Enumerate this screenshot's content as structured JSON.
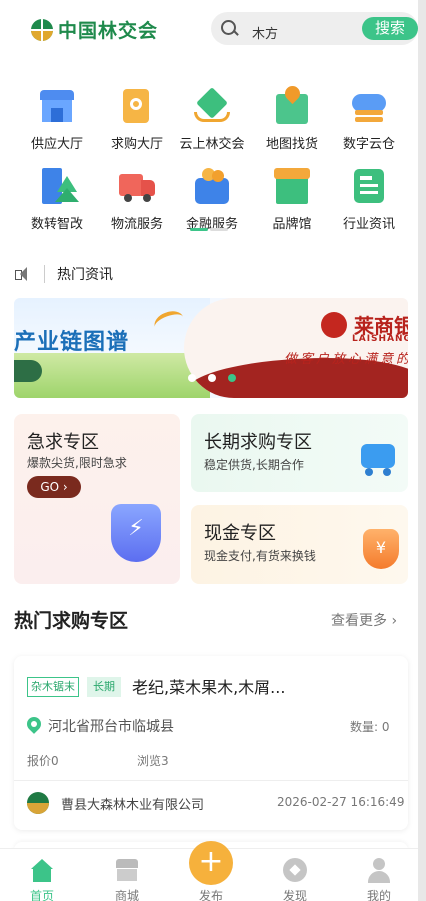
{
  "header": {
    "logo_text": "中国林交会",
    "search_value": "木方",
    "search_button": "搜索"
  },
  "grid": [
    {
      "label": "供应大厅",
      "icon": "warehouse-icon"
    },
    {
      "label": "求购大厅",
      "icon": "purchase-search-icon"
    },
    {
      "label": "云上林交会",
      "icon": "cloud-fair-cube-icon"
    },
    {
      "label": "地图找货",
      "icon": "map-pin-icon"
    },
    {
      "label": "数字云仓",
      "icon": "cloud-storage-icon"
    },
    {
      "label": "数转智改",
      "icon": "digital-building-tree-icon"
    },
    {
      "label": "物流服务",
      "icon": "truck-icon"
    },
    {
      "label": "金融服务",
      "icon": "wallet-coins-icon"
    },
    {
      "label": "品牌馆",
      "icon": "brand-hall-icon"
    },
    {
      "label": "行业资讯",
      "icon": "news-doc-icon"
    }
  ],
  "news": {
    "label": "热门资讯"
  },
  "banner": {
    "left_text": "产业链图谱",
    "brand": "莱商银",
    "brand_en": "LAISHANG",
    "slogan": "做客户放心满意的"
  },
  "zones": {
    "urgent": {
      "title": "急求专区",
      "subtitle": "爆款尖货,限时急求",
      "button": "GO ›"
    },
    "long_term": {
      "title": "长期求购专区",
      "subtitle": "稳定供货,长期合作"
    },
    "cash": {
      "title": "现金专区",
      "subtitle": "现金支付,有货来换钱"
    }
  },
  "hot": {
    "title": "热门求购专区",
    "more": "查看更多 ›",
    "card": {
      "tag_category": "杂木锯末",
      "tag_type": "长期",
      "title": "老纪,菜木果木,木屑...",
      "location": "河北省邢台市临城县",
      "quantity": "数量: 0",
      "quotes": "报价0",
      "views": "浏览3",
      "company": "曹县大森林木业有限公司",
      "time": "2026-02-27 16:16:49"
    }
  },
  "tabbar": {
    "home": "首页",
    "mall": "商城",
    "publish": "发布",
    "discover": "发现",
    "mine": "我的"
  },
  "colors": {
    "brand_green": "#1f8a4c",
    "accent_green": "#3cc489",
    "publish_orange": "#f6b13c"
  }
}
